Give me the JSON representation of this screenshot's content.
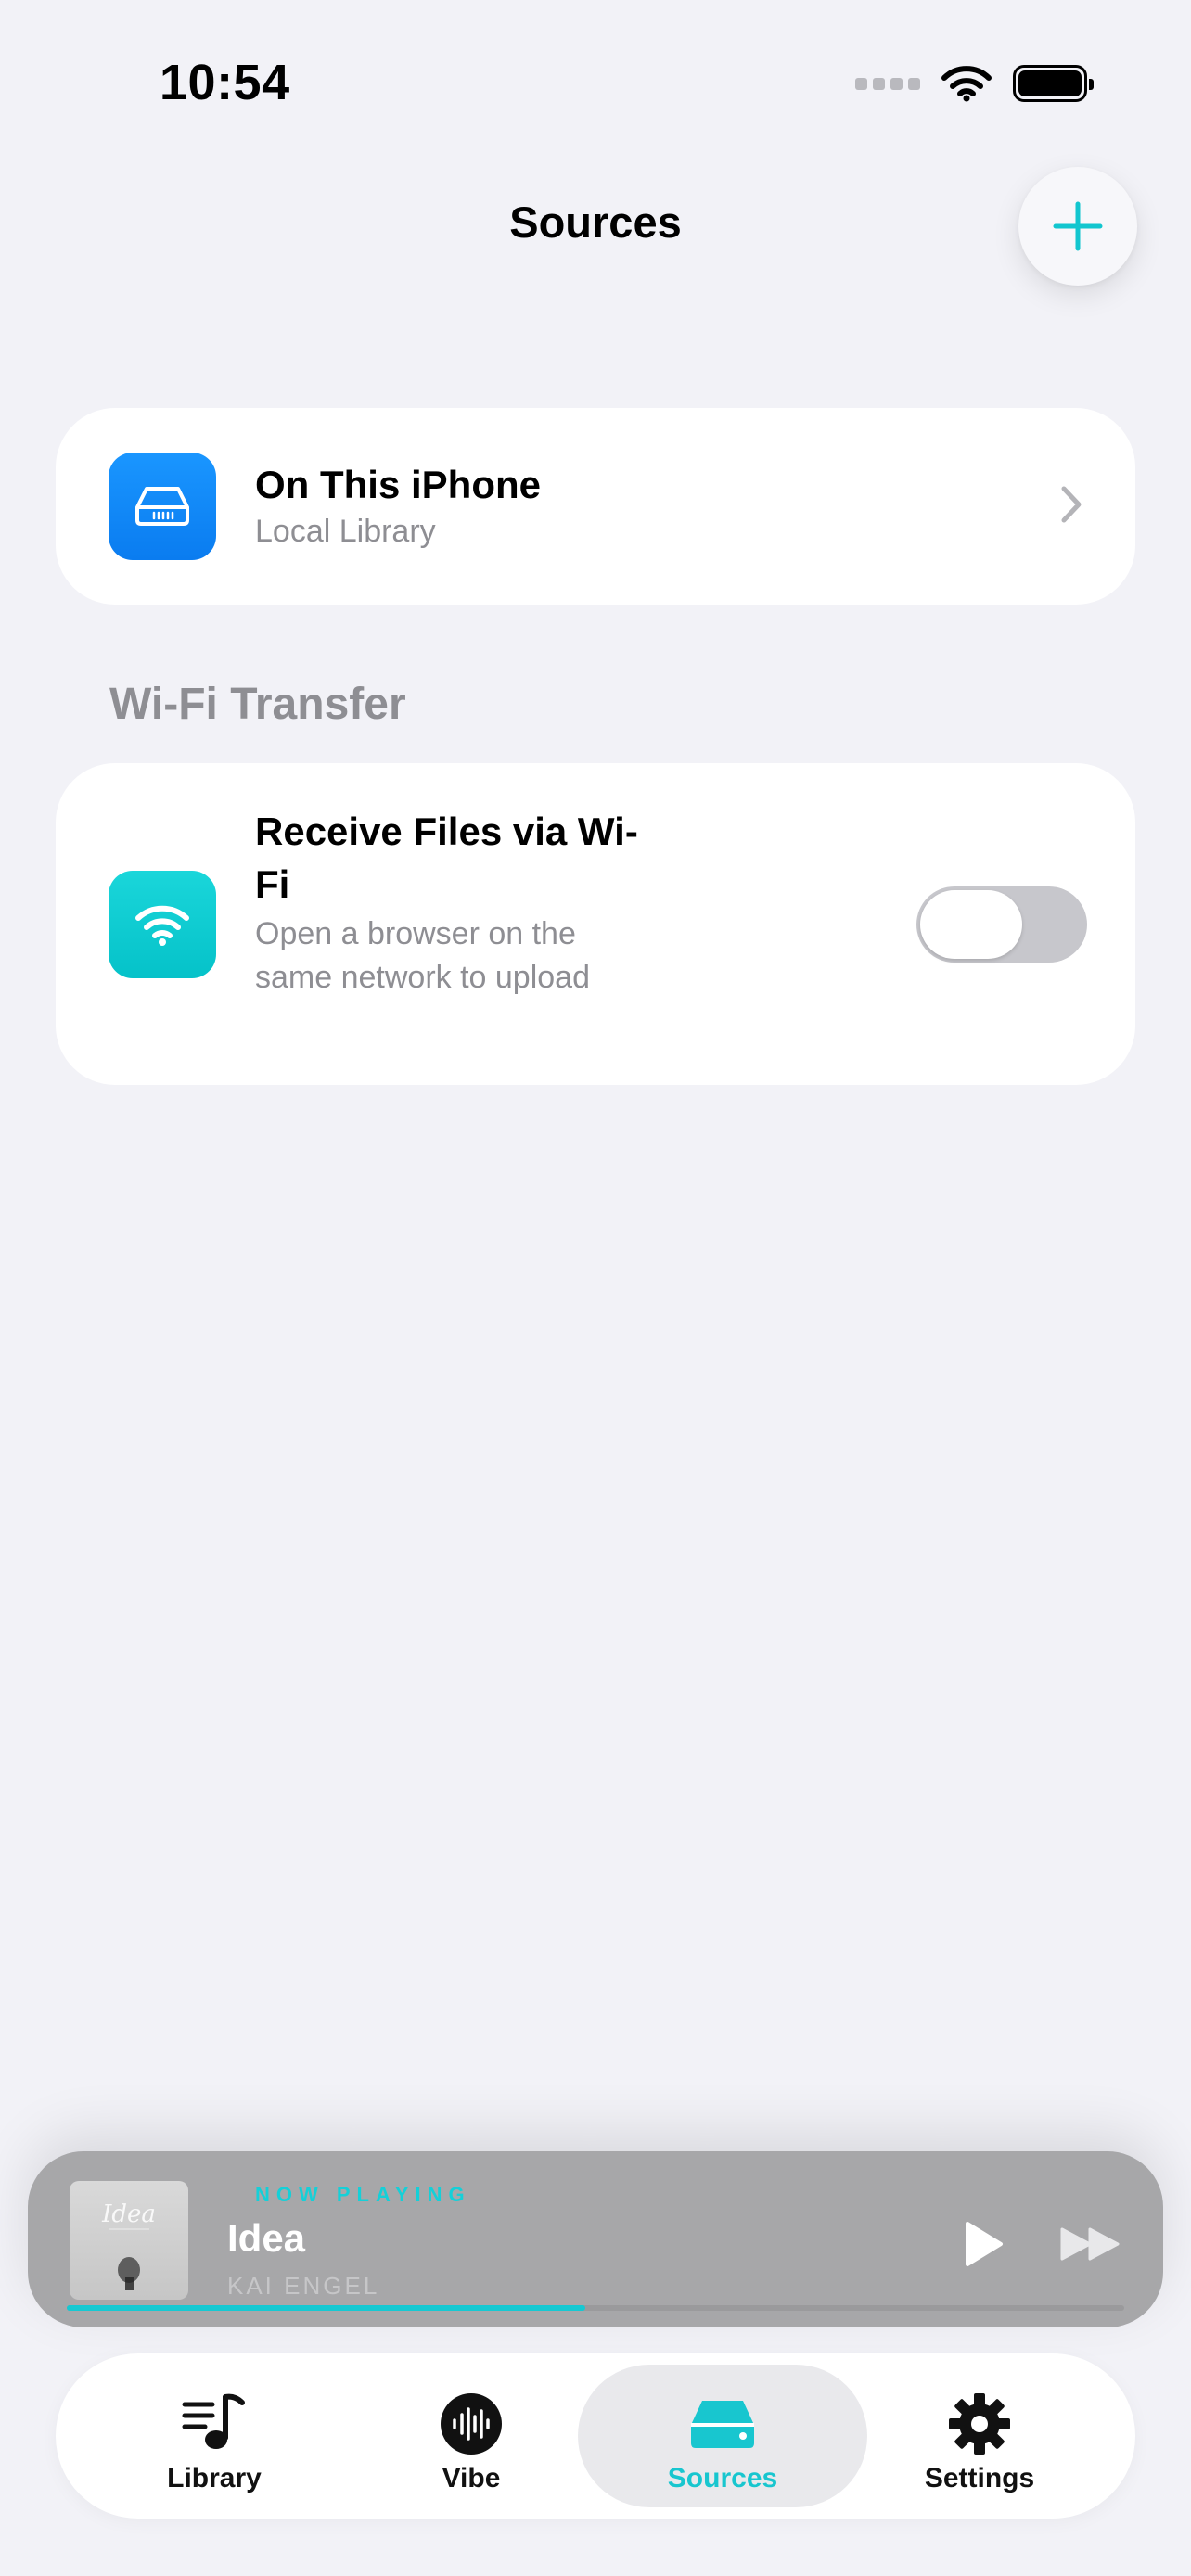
{
  "status_bar": {
    "time": "10:54"
  },
  "header": {
    "title": "Sources",
    "add_icon": "plus-icon"
  },
  "local_source": {
    "title": "On This iPhone",
    "subtitle": "Local Library",
    "icon": "drive-icon",
    "icon_color": "#0a84ff"
  },
  "wifi_section": {
    "header": "Wi-Fi Transfer",
    "title": "Receive Files via Wi-Fi",
    "subtitle": "Open a browser on the same network to upload",
    "icon": "wifi-icon",
    "icon_color": "#05c7cd",
    "toggle_on": false
  },
  "now_playing": {
    "label": "NOW PLAYING",
    "title": "Idea",
    "artist": "KAI ENGEL",
    "artwork_text": "Idea",
    "progress": 0.49,
    "accent": "#15c8d2"
  },
  "tabs": [
    {
      "label": "Library",
      "icon": "music-library-icon",
      "active": false
    },
    {
      "label": "Vibe",
      "icon": "waveform-icon",
      "active": false
    },
    {
      "label": "Sources",
      "icon": "drive-icon",
      "active": true
    },
    {
      "label": "Settings",
      "icon": "gear-icon",
      "active": false
    }
  ]
}
